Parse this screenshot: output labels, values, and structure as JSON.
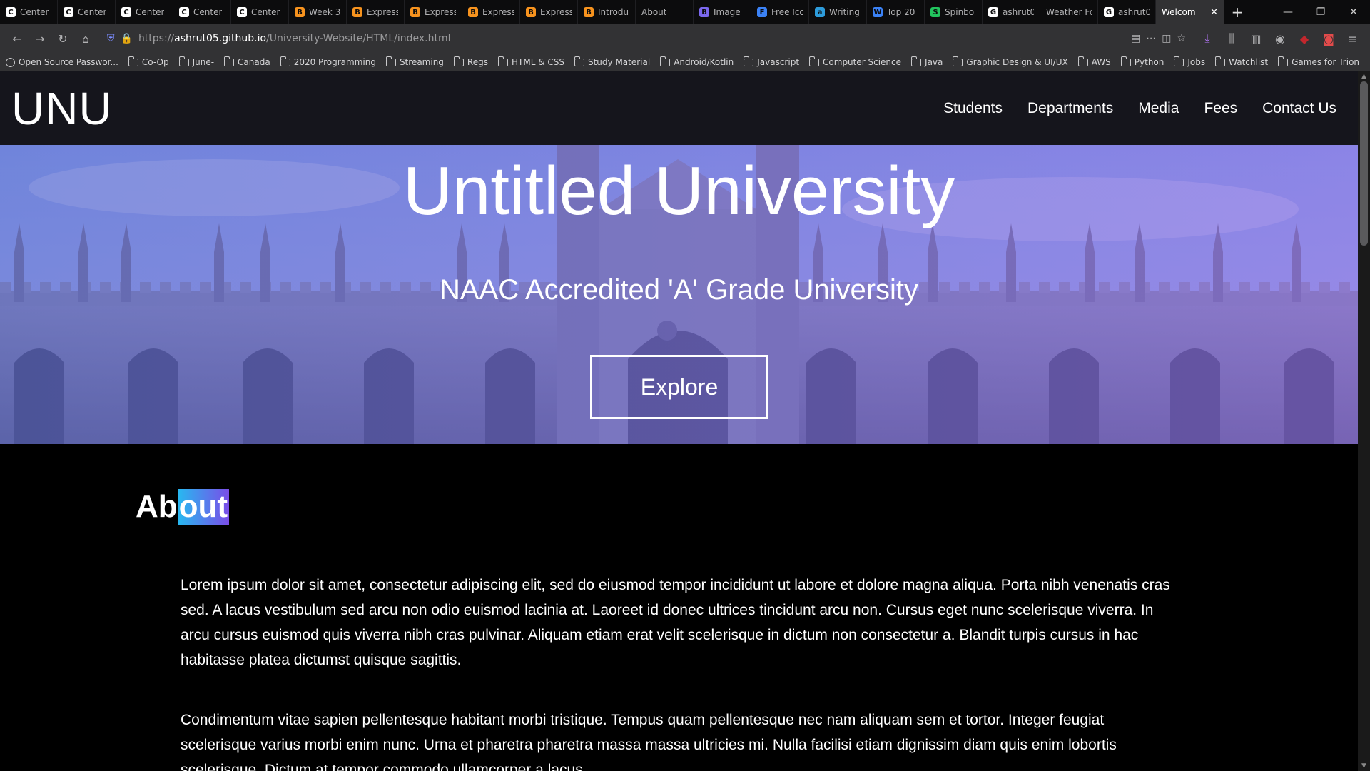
{
  "browser": {
    "tabs": [
      {
        "label": "Center",
        "icon": "C",
        "color": "#ffffff"
      },
      {
        "label": "Center",
        "icon": "C",
        "color": "#ffffff"
      },
      {
        "label": "Center",
        "icon": "C",
        "color": "#ffffff"
      },
      {
        "label": "Center",
        "icon": "C",
        "color": "#ffffff"
      },
      {
        "label": "Center",
        "icon": "C",
        "color": "#ffffff"
      },
      {
        "label": "Week 3",
        "icon": "B",
        "color": "#f7931e"
      },
      {
        "label": "Express",
        "icon": "B",
        "color": "#f7931e"
      },
      {
        "label": "Express",
        "icon": "B",
        "color": "#f7931e"
      },
      {
        "label": "Express",
        "icon": "B",
        "color": "#f7931e"
      },
      {
        "label": "Express",
        "icon": "B",
        "color": "#f7931e"
      },
      {
        "label": "Introdu",
        "icon": "B",
        "color": "#f7931e"
      },
      {
        "label": "About",
        "icon": "",
        "color": ""
      },
      {
        "label": "Image",
        "icon": "B",
        "color": "#7b68ee"
      },
      {
        "label": "Free Ico",
        "icon": "F",
        "color": "#3b82f6"
      },
      {
        "label": "Writing",
        "icon": "a",
        "color": "#2d9cdb"
      },
      {
        "label": "Top 20",
        "icon": "W",
        "color": "#3b82f6"
      },
      {
        "label": "Spinbo",
        "icon": "S",
        "color": "#22c55e"
      },
      {
        "label": "ashrut0",
        "icon": "G",
        "color": "#ffffff"
      },
      {
        "label": "Weather Fo",
        "icon": "",
        "color": ""
      },
      {
        "label": "ashrut0",
        "icon": "G",
        "color": "#ffffff"
      }
    ],
    "active_tab": {
      "label": "Welcom"
    },
    "url": {
      "scheme": "https://",
      "host": "ashrut05.github.io",
      "path": "/University-Website/HTML/index.html"
    },
    "bookmarks": [
      {
        "label": "Open Source Passwor...",
        "type": "site"
      },
      {
        "label": "Co-Op",
        "type": "folder"
      },
      {
        "label": "June-",
        "type": "folder"
      },
      {
        "label": "Canada",
        "type": "folder"
      },
      {
        "label": "2020 Programming",
        "type": "folder"
      },
      {
        "label": "Streaming",
        "type": "folder"
      },
      {
        "label": "Regs",
        "type": "folder"
      },
      {
        "label": "HTML & CSS",
        "type": "folder"
      },
      {
        "label": "Study Material",
        "type": "folder"
      },
      {
        "label": "Android/Kotlin",
        "type": "folder"
      },
      {
        "label": "Javascript",
        "type": "folder"
      },
      {
        "label": "Computer Science",
        "type": "folder"
      },
      {
        "label": "Java",
        "type": "folder"
      },
      {
        "label": "Graphic Design & UI/UX",
        "type": "folder"
      },
      {
        "label": "AWS",
        "type": "folder"
      },
      {
        "label": "Python",
        "type": "folder"
      },
      {
        "label": "Jobs",
        "type": "folder"
      },
      {
        "label": "Watchlist",
        "type": "folder"
      },
      {
        "label": "Games for Trion",
        "type": "folder"
      }
    ]
  },
  "site": {
    "logo": "UNU",
    "nav": [
      "Students",
      "Departments",
      "Media",
      "Fees",
      "Contact Us"
    ],
    "hero": {
      "title": "Untitled University",
      "subtitle": "NAAC Accredited 'A' Grade University",
      "cta": "Explore"
    },
    "about": {
      "heading_plain": "Ab",
      "heading_highlight": "out",
      "paragraphs": [
        "Lorem ipsum dolor sit amet, consectetur adipiscing elit, sed do eiusmod tempor incididunt ut labore et dolore magna aliqua. Porta nibh venenatis cras sed. A lacus vestibulum sed arcu non odio euismod lacinia at. Laoreet id donec ultrices tincidunt arcu non. Cursus eget nunc scelerisque viverra. In arcu cursus euismod quis viverra nibh cras pulvinar. Aliquam etiam erat velit scelerisque in dictum non consectetur a. Blandit turpis cursus in hac habitasse platea dictumst quisque sagittis.",
        "Condimentum vitae sapien pellentesque habitant morbi tristique. Tempus quam pellentesque nec nam aliquam sem et tortor. Integer feugiat scelerisque varius morbi enim nunc. Urna et pharetra pharetra massa massa ultricies mi. Nulla facilisi etiam dignissim diam quis enim lobortis scelerisque. Dictum at tempor commodo ullamcorper a lacus."
      ]
    }
  }
}
